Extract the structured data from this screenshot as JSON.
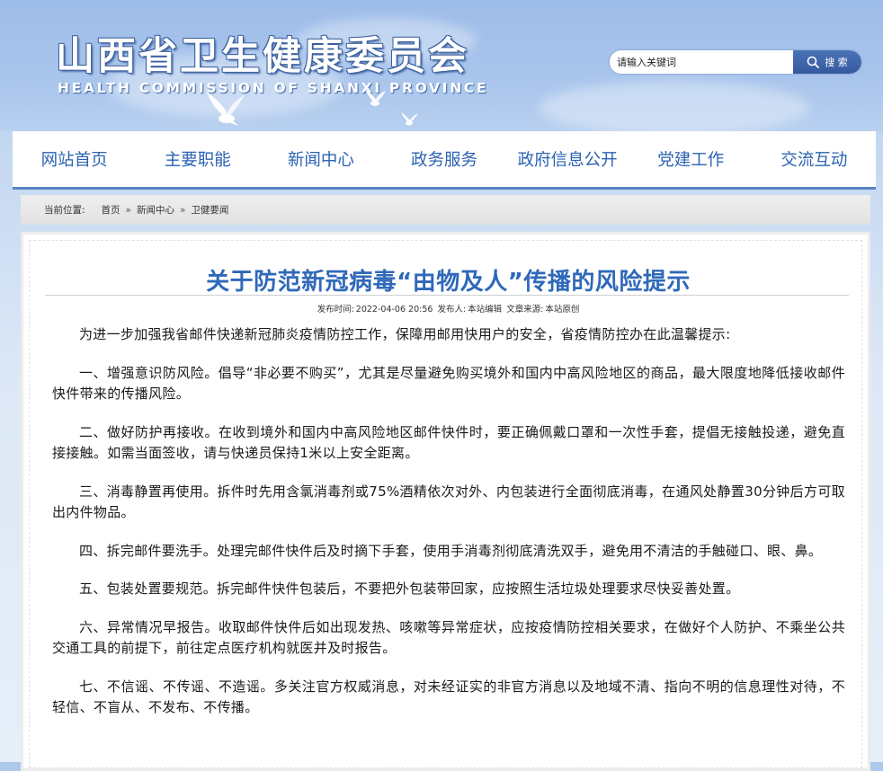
{
  "header": {
    "logo_cn": "山西省卫生健康委员会",
    "logo_en": "HEALTH COMMISSION OF SHANXI PROVINCE",
    "search_placeholder": "请输入关键词",
    "search_button": "搜 索"
  },
  "nav": {
    "items": [
      "网站首页",
      "主要职能",
      "新闻中心",
      "政务服务",
      "政府信息公开",
      "党建工作",
      "交流互动"
    ]
  },
  "breadcrumb": {
    "label": "当前位置:",
    "items": [
      "首页",
      "新闻中心",
      "卫健要闻"
    ],
    "separator": "»"
  },
  "article": {
    "title": "关于防范新冠病毒“由物及人”传播的风险提示",
    "meta": {
      "time_label": "发布时间:",
      "time": "2022-04-06 20:56",
      "author_label": "发布人:",
      "author": "本站编辑",
      "source_label": "文章来源:",
      "source": "本站原创"
    },
    "paragraphs": [
      "为进一步加强我省邮件快递新冠肺炎疫情防控工作，保障用邮用快用户的安全，省疫情防控办在此温馨提示:",
      "一、增强意识防风险。倡导“非必要不购买”，尤其是尽量避免购买境外和国内中高风险地区的商品，最大限度地降低接收邮件快件带来的传播风险。",
      "二、做好防护再接收。在收到境外和国内中高风险地区邮件快件时，要正确佩戴口罩和一次性手套，提倡无接触投递，避免直接接触。如需当面签收，请与快递员保持1米以上安全距离。",
      "三、消毒静置再使用。拆件时先用含氯消毒剂或75%酒精依次对外、内包装进行全面彻底消毒，在通风处静置30分钟后方可取出内件物品。",
      "四、拆完邮件要洗手。处理完邮件快件后及时摘下手套，使用手消毒剂彻底清洗双手，避免用不清洁的手触碰口、眼、鼻。",
      "五、包装处置要规范。拆完邮件快件包装后，不要把外包装带回家，应按照生活垃圾处理要求尽快妥善处置。",
      "六、异常情况早报告。收取邮件快件后如出现发热、咳嗽等异常症状，应按疫情防控相关要求，在做好个人防护、不乘坐公共交通工具的前提下，前往定点医疗机构就医并及时报告。",
      "七、不信谣、不传谣、不造谣。多关注官方权威消息，对未经证实的非官方消息以及地域不清、指向不明的信息理性对待，不轻信、不盲从、不发布、不传播。"
    ]
  },
  "colors": {
    "nav_text": "#2c63b3",
    "title": "#2f69b9",
    "search_button": "#3d63a8"
  }
}
